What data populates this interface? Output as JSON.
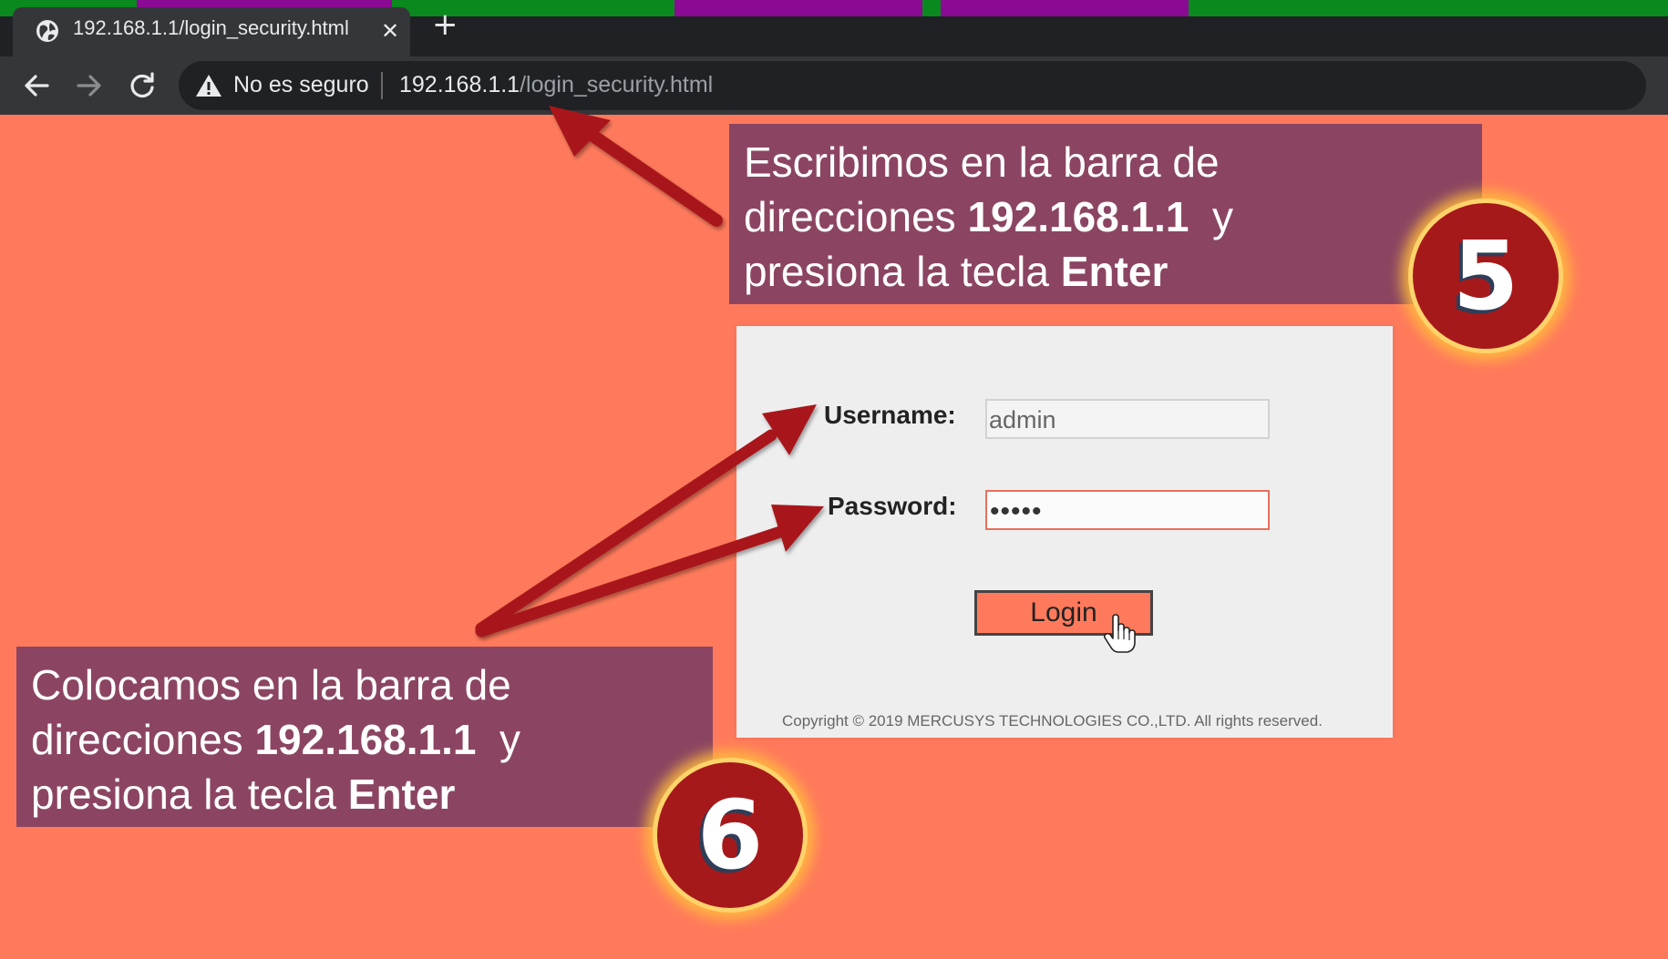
{
  "browser": {
    "tab_title": "192.168.1.1/login_security.html",
    "security_label": "No es seguro",
    "url_host": "192.168.1.1",
    "url_path": "/login_security.html",
    "top_strip_colors": [
      "#0a8a1e",
      "#8b0a94",
      "#0a8a1e",
      "#8b0a94",
      "#0a8a1e",
      "#8b0a94",
      "#0a8a1e"
    ]
  },
  "login": {
    "username_label": "Username:",
    "username_value": "admin",
    "password_label": "Password:",
    "password_value": "•••••",
    "login_button": "Login",
    "copyright": "Copyright © 2019 MERCUSYS TECHNOLOGIES CO.,LTD. All rights reserved."
  },
  "callout_5": {
    "line1": "Escribimos en la barra de",
    "line2_prefix": "direcciones ",
    "line2_bold": "192.168.1.1",
    "line2_suffix": "  y",
    "line3_prefix": "presiona la tecla ",
    "line3_bold": "Enter",
    "badge": "5"
  },
  "callout_6": {
    "line1": "Colocamos en la barra de",
    "line2_prefix": "direcciones ",
    "line2_bold": "192.168.1.1",
    "line2_suffix": "  y",
    "line3_prefix": "presiona la tecla ",
    "line3_bold": "Enter",
    "badge": "6"
  },
  "colors": {
    "background": "#ff7a5c",
    "callout_bg": "#8b4562",
    "badge_red": "#a6191b",
    "arrow_red": "#a8181a"
  }
}
